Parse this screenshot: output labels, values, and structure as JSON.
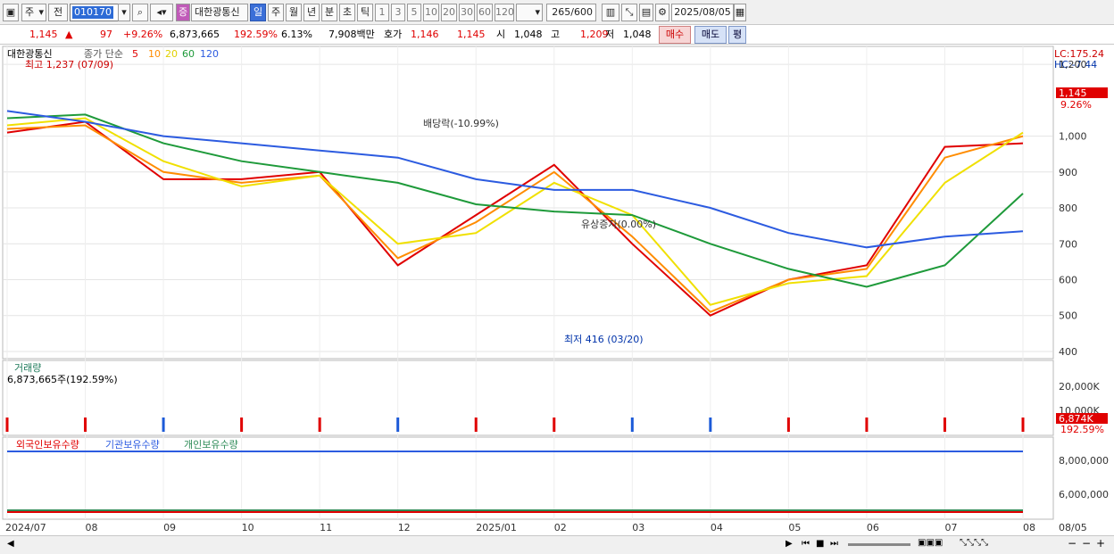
{
  "toolbar": {
    "period_main": "주",
    "period_prev": "전",
    "code": "010170",
    "stock_name": "대한광통신",
    "stock_badge": "증",
    "periods": [
      "일",
      "주",
      "월",
      "년",
      "분",
      "초",
      "틱"
    ],
    "selected_period": "일",
    "intervals": [
      "1",
      "3",
      "5",
      "10",
      "20",
      "30",
      "60",
      "120"
    ],
    "count": "265",
    "max_count": "/600",
    "date": "2025/08/05"
  },
  "infobar": {
    "price": "1,145",
    "arrow": "▲",
    "change": "97",
    "change_pct": "+9.26%",
    "volume": "6,873,665",
    "volume_ratio": "192.59%",
    "turnover": "6.13%",
    "amount": "7,908백만",
    "quote_label": "호가",
    "ask": "1,146",
    "bid": "1,145",
    "open_label": "시",
    "open": "1,048",
    "high_label": "고",
    "high": "1,209",
    "low_label": "저",
    "low": "1,048",
    "buy_label": "매수",
    "sell_label": "매도",
    "eval_label": "평"
  },
  "price_panel": {
    "title": "대한광통신",
    "ma_label": "종가 단순",
    "ma_periods": [
      "5",
      "10",
      "20",
      "60",
      "120"
    ],
    "high_note": "최고 1,237 (07/09)",
    "low_note": "최저 416 (03/20)",
    "dividend_note": "배당락(-10.99%)",
    "rights_note": "유상증자(0.00%)",
    "lc": "LC:175.24",
    "hc": "HC:-7.44",
    "last_tag": "1,145",
    "last_pct": "9.26%",
    "y_ticks": [
      "1,200",
      "1,000",
      "900",
      "800",
      "700",
      "600",
      "500",
      "400"
    ]
  },
  "volume_panel": {
    "title": "거래량",
    "value": "6,873,665주(192.59%)",
    "y_ticks": [
      "20,000K",
      "10,000K"
    ],
    "last_tag": "6,874K",
    "last_pct": "192.59%"
  },
  "holder_panel": {
    "labels": [
      "외국인보유수량",
      "기관보유수량",
      "개인보유수량"
    ],
    "y_ticks": [
      "8,000,000",
      "6,000,000"
    ]
  },
  "x_axis": [
    "2024/07",
    "08",
    "09",
    "10",
    "11",
    "12",
    "2025/01",
    "02",
    "03",
    "04",
    "05",
    "06",
    "07",
    "08",
    "08/05"
  ],
  "colors": {
    "ma5": "#e00000",
    "ma10": "#ff8c00",
    "ma20": "#f0e000",
    "ma60": "#1e9a3a",
    "ma120": "#2c5be0",
    "up": "#e00000",
    "down": "#1c5ad8",
    "foreign": "#e00000",
    "institution": "#2c5be0",
    "individual": "#2e8b57"
  },
  "chart_data": {
    "type": "line",
    "title": "대한광통신",
    "x": [
      "2024/07",
      "08",
      "09",
      "10",
      "11",
      "12",
      "2025/01",
      "02",
      "03",
      "04",
      "05",
      "06",
      "07",
      "08"
    ],
    "series": [
      {
        "name": "5",
        "values": [
          1010,
          1040,
          880,
          880,
          900,
          640,
          780,
          920,
          700,
          500,
          600,
          640,
          970,
          980
        ]
      },
      {
        "name": "10",
        "values": [
          1020,
          1030,
          900,
          870,
          890,
          660,
          760,
          900,
          720,
          510,
          600,
          630,
          940,
          1000
        ]
      },
      {
        "name": "20",
        "values": [
          1030,
          1050,
          930,
          860,
          890,
          700,
          730,
          870,
          780,
          530,
          590,
          610,
          870,
          1010
        ]
      },
      {
        "name": "60",
        "values": [
          1050,
          1060,
          980,
          930,
          900,
          870,
          810,
          790,
          780,
          700,
          630,
          580,
          640,
          840
        ]
      },
      {
        "name": "120",
        "values": [
          1070,
          1040,
          1000,
          980,
          960,
          940,
          880,
          850,
          850,
          800,
          730,
          690,
          720,
          735
        ]
      }
    ],
    "ylim": [
      380,
      1250
    ],
    "grid": true,
    "legend": "top-left"
  }
}
